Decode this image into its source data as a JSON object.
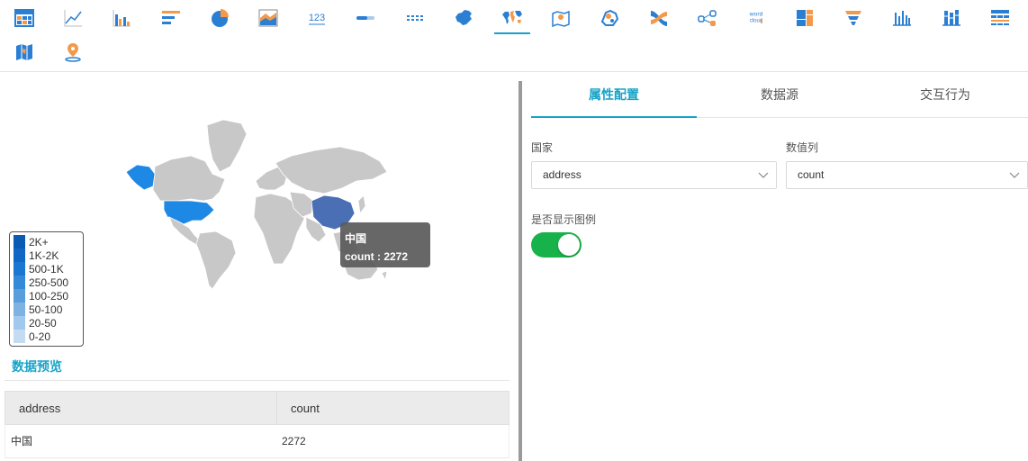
{
  "toolbar": {
    "row1": [
      {
        "icon": "table-chart-icon"
      },
      {
        "icon": "line-chart-icon"
      },
      {
        "icon": "bar-chart-icon"
      },
      {
        "icon": "horizontal-bar-chart-icon"
      },
      {
        "icon": "pie-chart-icon"
      },
      {
        "icon": "area-chart-icon"
      },
      {
        "icon": "kpi-number-icon",
        "text": "123"
      },
      {
        "icon": "progress-bar-icon"
      },
      {
        "icon": "pivot-grid-icon"
      },
      {
        "icon": "china-map-icon"
      },
      {
        "icon": "world-map-icon",
        "active": true
      },
      {
        "icon": "location-map-icon"
      },
      {
        "icon": "bubble-map-icon"
      },
      {
        "icon": "sankey-chart-icon"
      },
      {
        "icon": "relationship-graph-icon"
      },
      {
        "icon": "word-cloud-icon",
        "text": "word cloud"
      },
      {
        "icon": "treemap-icon"
      },
      {
        "icon": "funnel-chart-icon"
      },
      {
        "icon": "column-chart-icon"
      },
      {
        "icon": "stacked-column-icon"
      },
      {
        "icon": "cross-table-icon"
      }
    ],
    "row2": [
      {
        "icon": "region-map-icon"
      },
      {
        "icon": "point-map-icon"
      }
    ]
  },
  "colors": {
    "accent": "#17a3c7",
    "toggle_on": "#17b34a",
    "map_land": "#c8c8c8",
    "usa": "#1e88e5",
    "alaska": "#1e88e5",
    "china": "#4a6fb5"
  },
  "map": {
    "legend": [
      {
        "label": "2K+",
        "color": "#0b5bb5"
      },
      {
        "label": "1K-2K",
        "color": "#1267c4"
      },
      {
        "label": "500-1K",
        "color": "#1a78d2"
      },
      {
        "label": "250-500",
        "color": "#3489d8"
      },
      {
        "label": "100-250",
        "color": "#5a9ddc"
      },
      {
        "label": "50-100",
        "color": "#7db2e3"
      },
      {
        "label": "20-50",
        "color": "#a2c8ec"
      },
      {
        "label": "0-20",
        "color": "#c3dcf4"
      }
    ],
    "tooltip": {
      "name": "中国",
      "value_text": "count : 2272"
    }
  },
  "preview": {
    "title": "数据预览",
    "columns": [
      "address",
      "count"
    ],
    "rows": [
      [
        "中国",
        "2272"
      ]
    ]
  },
  "config": {
    "tabs": [
      {
        "label": "属性配置",
        "active": true
      },
      {
        "label": "数据源",
        "active": false
      },
      {
        "label": "交互行为",
        "active": false
      }
    ],
    "country_label": "国家",
    "country_value": "address",
    "value_label": "数值列",
    "value_value": "count",
    "legend_toggle_label": "是否显示图例",
    "legend_toggle_on": true
  }
}
